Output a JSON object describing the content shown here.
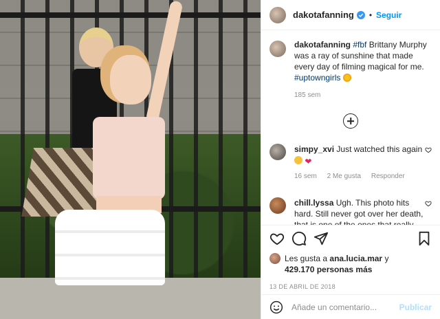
{
  "post": {
    "username": "dakotafanning",
    "follow_label": "Seguir",
    "dot": "•"
  },
  "caption": {
    "username": "dakotafanning",
    "text_prefix": "#fbf Brittany Murphy was a ray of sunshine that made every day of filming magical for me. ",
    "tag_prefix": "#fbf",
    "tag_suffix": "#uptowngirls",
    "age": "185 sem"
  },
  "comments": [
    {
      "username": "simpy_xvi",
      "text": "Just watched this again",
      "age": "16 sem",
      "likes": "2 Me gusta",
      "reply": "Responder"
    },
    {
      "username": "chill.lyssa",
      "text": "Ugh. This photo hits hard. Still never got over her death, that is one of the ones that really hurt and"
    }
  ],
  "likes": {
    "prefix": "Les gusta a",
    "user": "ana.lucia.mar",
    "connector": "y",
    "count": "429.170 personas más"
  },
  "date": "13 DE ABRIL DE 2018",
  "add_comment": {
    "placeholder": "Añade un comentario...",
    "publish_label": "Publicar"
  },
  "icons": {
    "like": "heart-icon",
    "comment": "comment-icon",
    "share": "share-icon",
    "save": "bookmark-icon",
    "emoji": "emoji-icon",
    "verified": "verified-badge-icon",
    "load_more": "plus-circle-icon"
  },
  "colors": {
    "accent": "#0095f6",
    "verified": "#3897f0",
    "hashtag": "#00376b",
    "muted": "#8e8e8e",
    "heart": "#e0245e"
  }
}
